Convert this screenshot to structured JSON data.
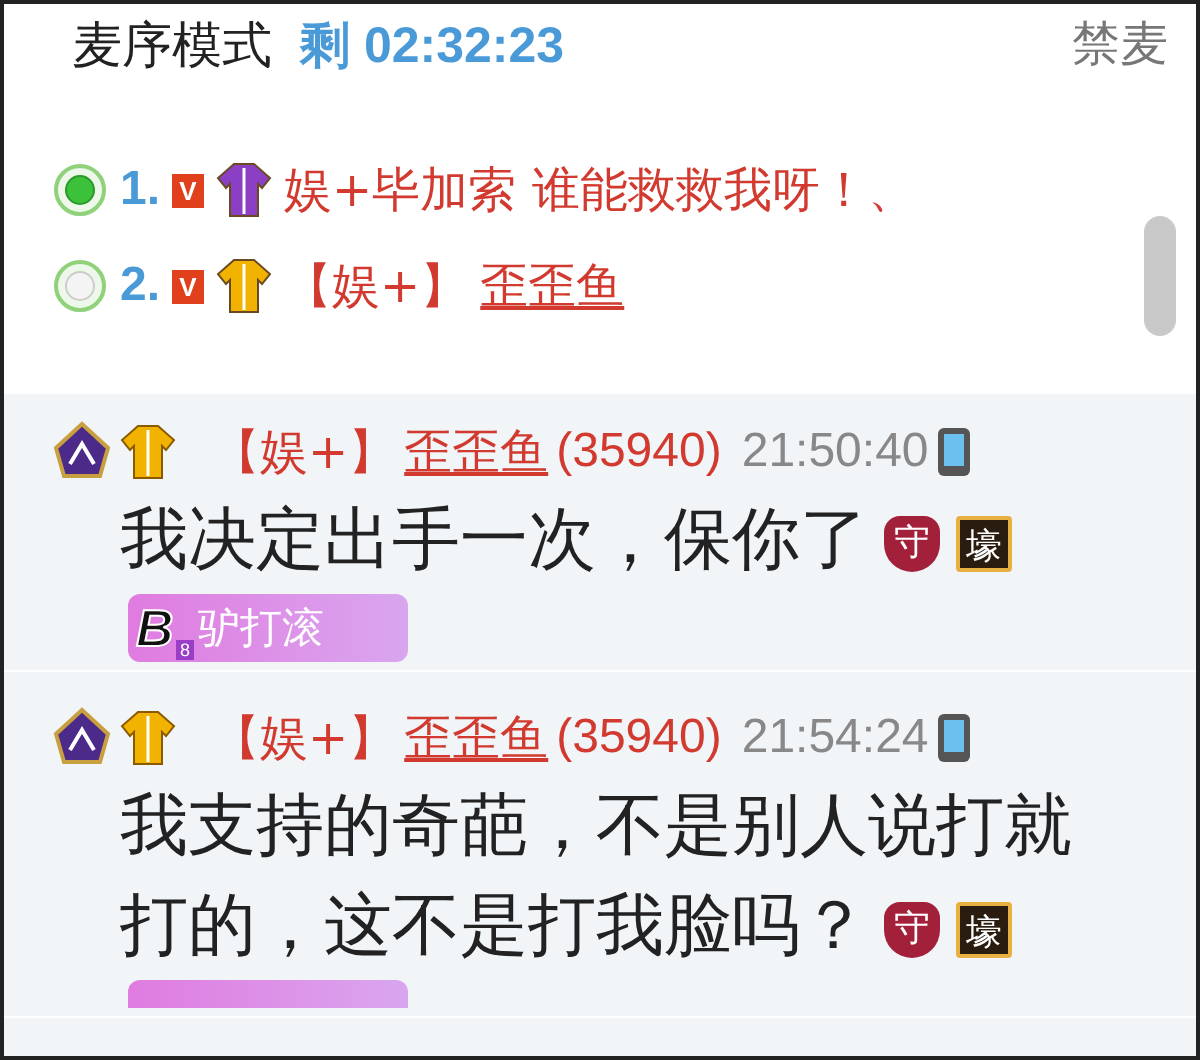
{
  "header": {
    "title": "麦序模式",
    "remaining": "剩 02:32:23",
    "ban_button": "禁麦"
  },
  "queue": [
    {
      "number": "1.",
      "vip": "V",
      "color": "#8a3fc4",
      "speaking": true,
      "name": "娱+毕加索 谁能救救我呀！、"
    },
    {
      "number": "2.",
      "vip": "V",
      "color": "#f2b300",
      "speaking": false,
      "tag": "【娱+】",
      "name": "歪歪鱼"
    }
  ],
  "messages": [
    {
      "color": "#f2b300",
      "tag": "【娱+】",
      "name": "歪歪鱼",
      "id": "(35940)",
      "time": "21:50:40",
      "text": "我决定出手一次，保你了",
      "badges": [
        "守",
        "壕"
      ],
      "fan_badge": {
        "letter": "B",
        "level": "8",
        "name": "驴打滚"
      }
    },
    {
      "color": "#f2b300",
      "tag": "【娱+】",
      "name": "歪歪鱼",
      "id": "(35940)",
      "time": "21:54:24",
      "text": "我支持的奇葩，不是别人说打就打的，这不是打我脸吗？",
      "badges": [
        "守",
        "壕"
      ],
      "fan_badge_cut": true
    }
  ]
}
